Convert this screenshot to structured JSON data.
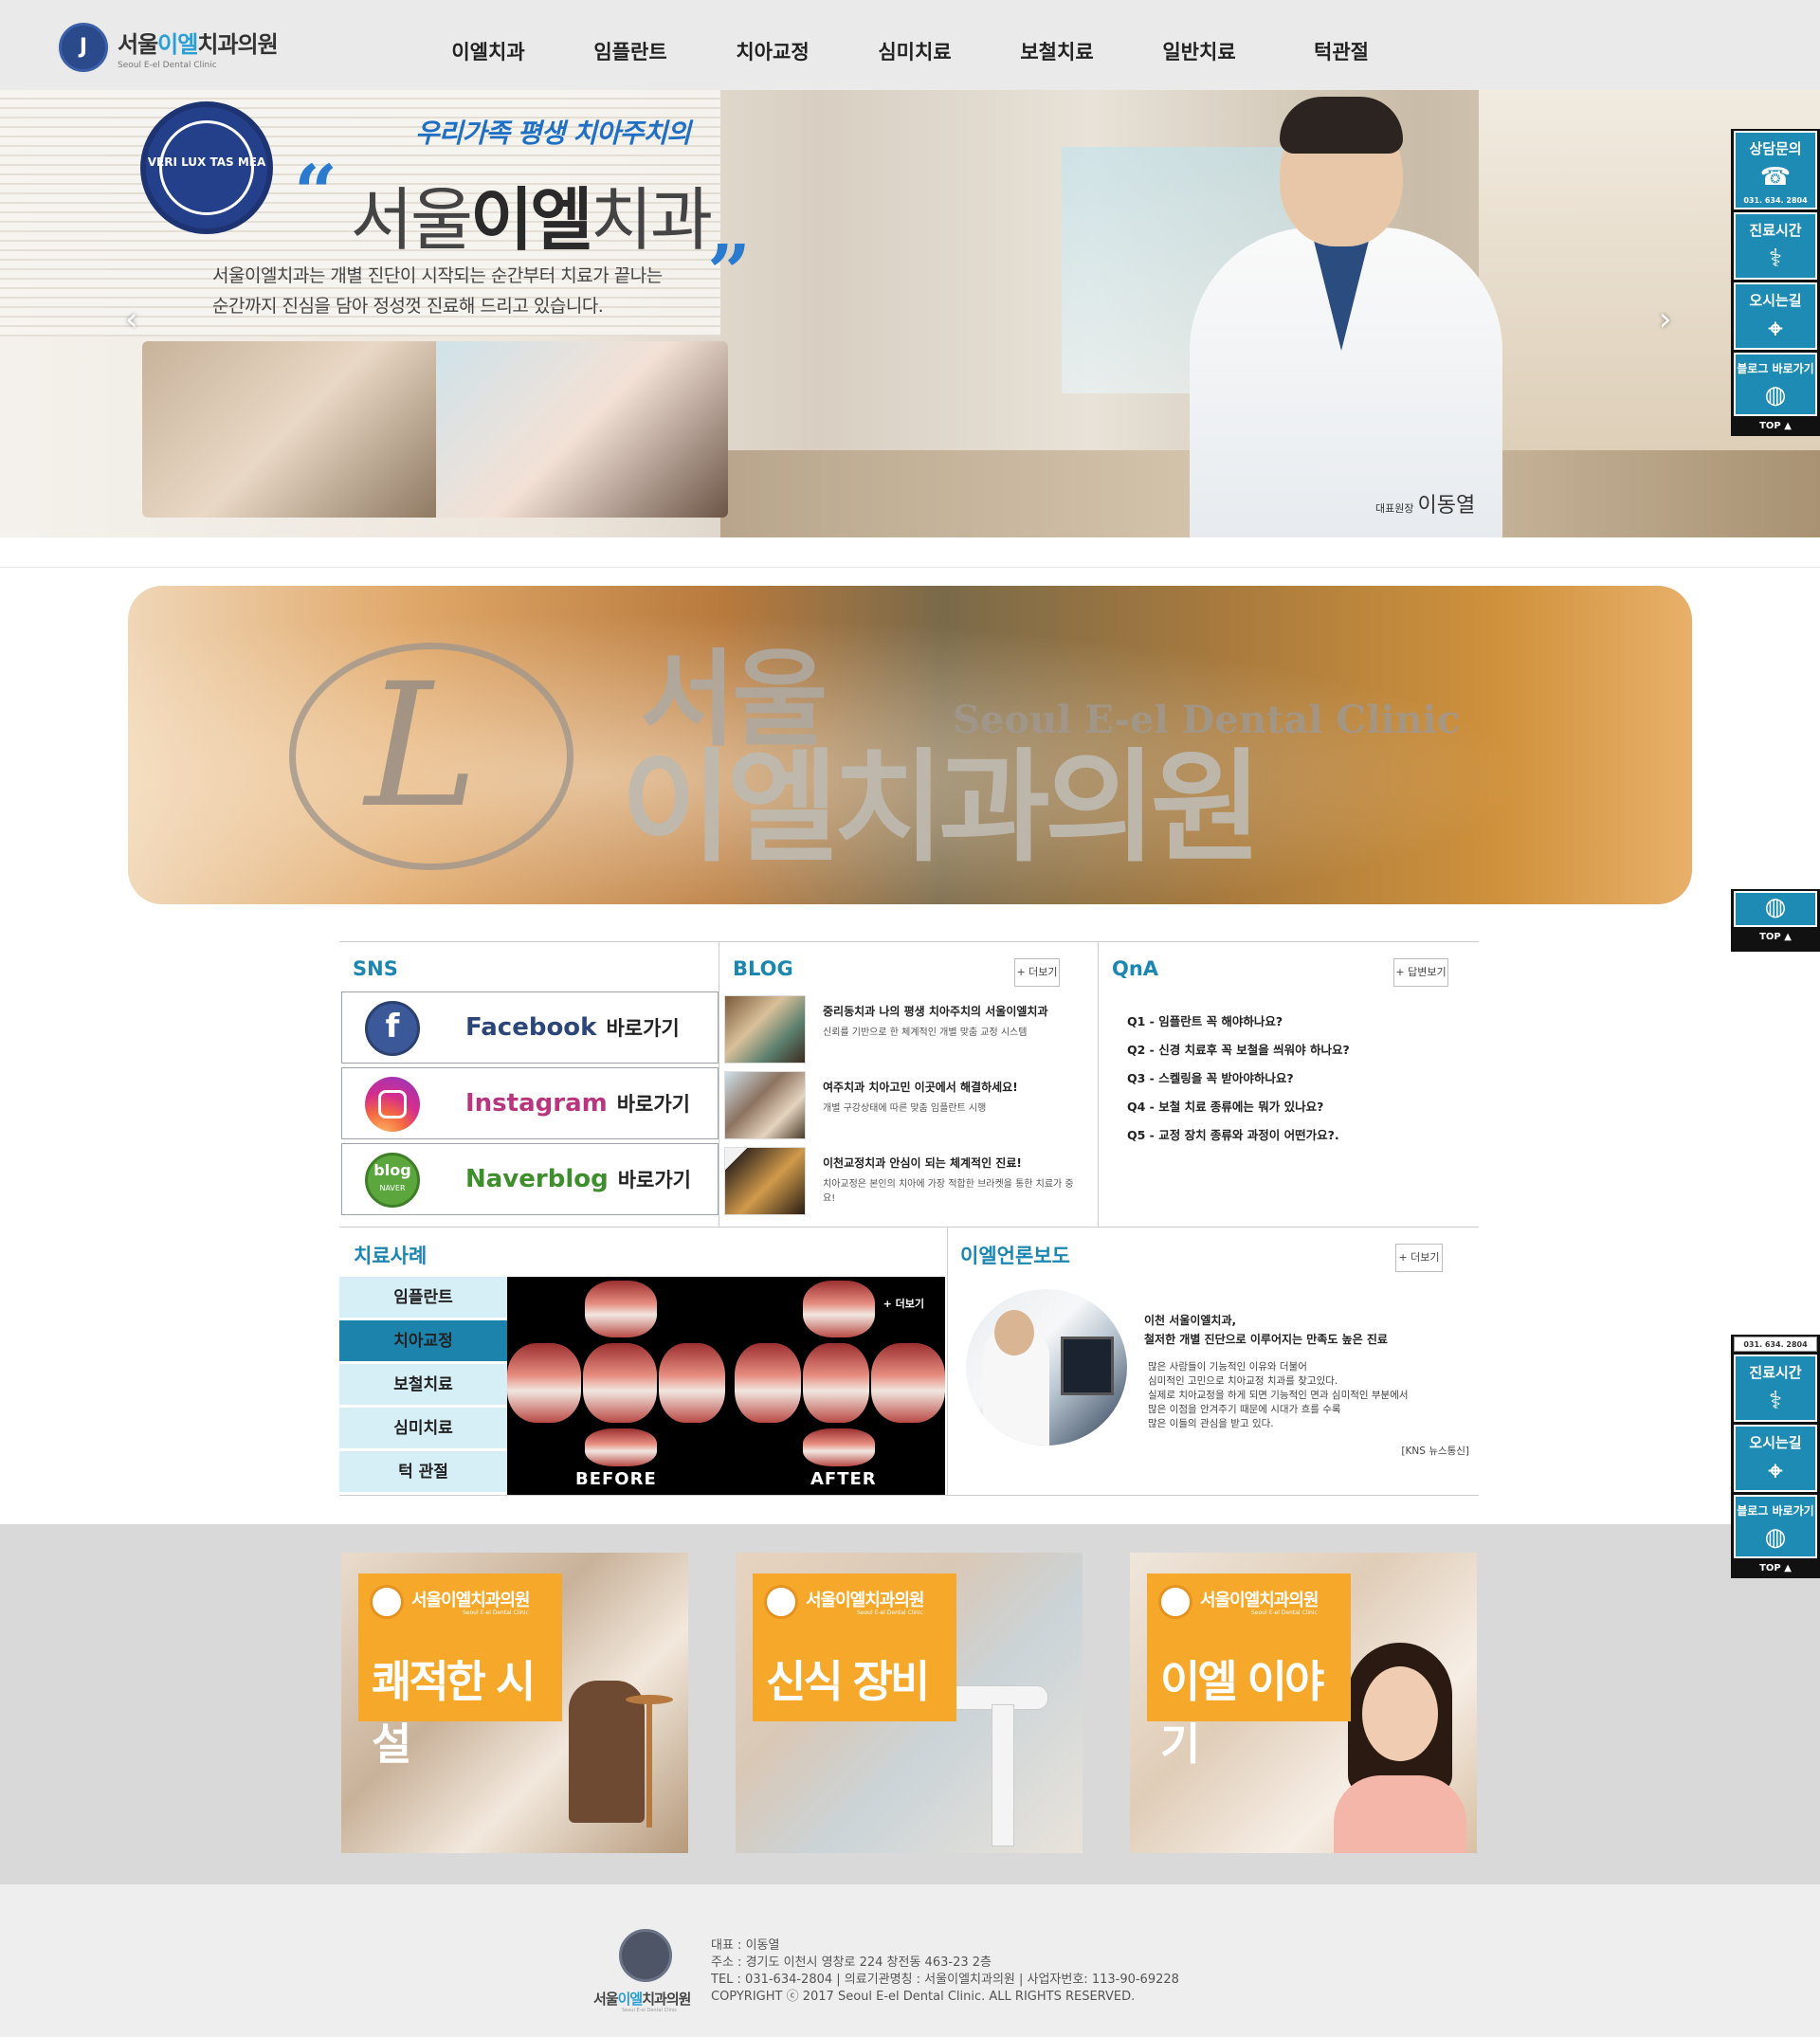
{
  "header": {
    "logo_text_1": "서울",
    "logo_text_2": "이엘",
    "logo_text_3": "치과의원",
    "logo_sub": "Seoul E-el Dental Clinic",
    "nav": [
      "이엘치과",
      "임플란트",
      "치아교정",
      "심미치료",
      "보철치료",
      "일반치료",
      "턱관절"
    ]
  },
  "hero": {
    "seal_text": "VERI LUX TAS MEA",
    "eyebrow": "우리가족 평생 치아주치의",
    "quote_open": "“",
    "quote_close": "”",
    "title_1": "서울",
    "title_2": "이엘",
    "title_3": "치과",
    "desc_1": "서울이엘치과는 개별 진단이 시작되는 순간부터 치료가 끝나는",
    "desc_2": "순간까지 진심을 담아 정성껏 진료해 드리고 있습니다.",
    "caption_role": "대표원장",
    "caption_name": "이동열",
    "prev_icon": "‹",
    "next_icon": "›"
  },
  "brand_banner": {
    "monogram": "L",
    "ko_1": "서울",
    "ko_2": "이엘치과의원",
    "en": "Seoul E-el Dental Clinic"
  },
  "sns": {
    "title": "SNS",
    "items": [
      {
        "name": "Facebook",
        "go": "바로가기"
      },
      {
        "name": "Instagram",
        "go": "바로가기"
      },
      {
        "name": "Naverblog",
        "go": "바로가기"
      }
    ],
    "naver_icon_text": "blog",
    "naver_icon_sub": "NAVER"
  },
  "blog": {
    "title": "BLOG",
    "more": "+ 더보기",
    "items": [
      {
        "title": "중리동치과 나의 평생 치아주치의 서울이엘치과",
        "desc": "신뢰를 기반으로 한 체계적인 개별 맞춤 교정 시스템"
      },
      {
        "title": "여주치과 치아고민 이곳에서 해결하세요!",
        "desc": "개별 구강상태에 따른 맞춤 임플란트 시행"
      },
      {
        "title": "이천교정치과 안심이 되는 체계적인 진료!",
        "desc": "치아교정은 본인의 치아에 가장 적합한 브라켓을 통한 치료가 중요!"
      }
    ]
  },
  "qna": {
    "title": "QnA",
    "more": "+ 답변보기",
    "items": [
      "Q1 - 임플란트 꼭 해야하나요?",
      "Q2 - 신경 치료후 꼭 보철을 씌워야 하나요?",
      "Q3 - 스켈링을 꼭 받아야하나요?",
      "Q4 - 보철 치료 종류에는 뭐가 있나요?",
      "Q5 - 교정 장치 종류와 과정이 어떤가요?."
    ]
  },
  "cases": {
    "title": "치료사례",
    "tabs": [
      "임플란트",
      "치아교정",
      "보철치료",
      "심미치료",
      "턱 관절"
    ],
    "active_tab": 1,
    "more": "+ 더보기",
    "before": "BEFORE",
    "after": "AFTER"
  },
  "press": {
    "title": "이엘언론보도",
    "more": "+ 더보기",
    "head_1": "이천 서울이엘치과,",
    "head_2": "철저한 개별 진단으로 이루어지는 만족도 높은 진료",
    "body": [
      "많은 사람들이 기능적인 이유와 더불어",
      "심미적인 고민으로 치아교정 치과를 찾고있다.",
      "실제로 치아교정을 하게 되면 기능적인 면과 심미적인 부분에서",
      "많은 이점을 안겨주기 때문에 시대가 흐를 수록",
      "많은 이들의 관심을 받고 있다."
    ],
    "source": "[KNS 뉴스통신]"
  },
  "promo": {
    "brand": "서울이엘치과의원",
    "brand_sub": "Seoul E-el Dental Clinic",
    "cards": [
      "쾌적한 시설",
      "신식 장비",
      "이엘 이야기"
    ]
  },
  "footer": {
    "brand_1": "서울",
    "brand_2": "이엘",
    "brand_3": "치과의원",
    "brand_sub": "Seoul E-el Dental Clinic",
    "lines": [
      "대표 : 이동열",
      "주소 : 경기도 이천시 영창로 224 창전동 463-23 2층",
      "TEL : 031-634-2804 | 의료기관명칭 : 서울이엘치과의원 | 사업자번호: 113-90-69228",
      "COPYRIGHT ⓒ 2017 Seoul E-el Dental Clinic. ALL RIGHTS RESERVED."
    ]
  },
  "quick": {
    "consult": "상담문의",
    "phone": "031. 634. 2804",
    "hours": "진료시간",
    "directions": "오시는길",
    "blog": "블로그 바로가기",
    "top": "TOP ▲",
    "phone_icon": "☎",
    "hours_icon": "⚕",
    "map_icon": "⌖",
    "globe_icon": "◍"
  },
  "colors": {
    "accent": "#1b86b0",
    "active_tab": "#1c84ac",
    "tab_bg": "#d6eef6",
    "promo_orange": "#f5a82a",
    "quick_bg": "#1d8bb3"
  }
}
